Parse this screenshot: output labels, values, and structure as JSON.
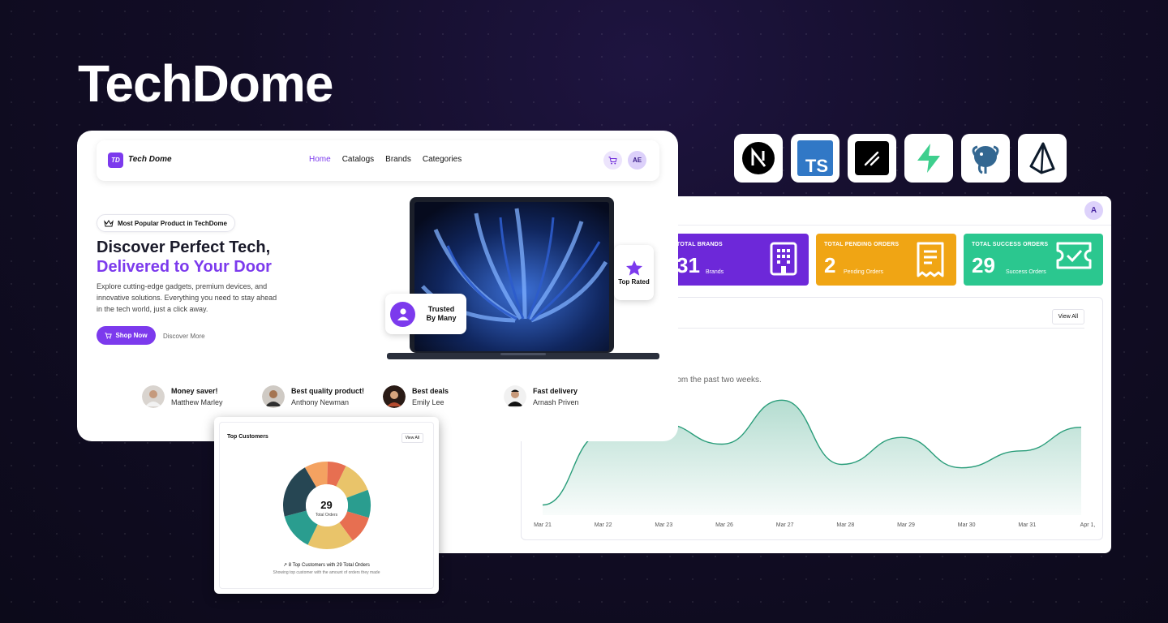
{
  "page_title": "TechDome",
  "badges": [
    "nextjs-icon",
    "typescript-icon",
    "shadcn-icon",
    "supabase-icon",
    "postgresql-icon",
    "prisma-icon"
  ],
  "badge_ts_text": "TS",
  "dashboard": {
    "avatar": "A",
    "stats": [
      {
        "label": "TOTAL BRANDS",
        "value": "31",
        "sub": "Brands",
        "color": "#6d28d9"
      },
      {
        "label": "TOTAL PENDING ORDERS",
        "value": "2",
        "sub": "Pending Orders",
        "color": "#f0a514"
      },
      {
        "label": "TOTAL SUCCESS ORDERS",
        "value": "29",
        "sub": "Success Orders",
        "color": "#2bc78f"
      }
    ],
    "view_all": "View All",
    "description": "rom the past two weeks.",
    "x_labels": [
      "Mar 21",
      "Mar 22",
      "Mar 23",
      "Mar 26",
      "Mar 27",
      "Mar 28",
      "Mar 29",
      "Mar 30",
      "Mar 31",
      "Apr 1,"
    ]
  },
  "chart_data": {
    "type": "area",
    "categories": [
      "Mar 21",
      "Mar 22",
      "Mar 23",
      "Mar 26",
      "Mar 27",
      "Mar 28",
      "Mar 29",
      "Mar 30",
      "Mar 31",
      "Apr 1,"
    ],
    "values": [
      0.3,
      2.4,
      2.7,
      2.1,
      3.4,
      1.5,
      2.3,
      1.4,
      1.9,
      2.6
    ],
    "title": "",
    "xlabel": "",
    "ylabel": "",
    "color": "#2a9d7a",
    "grid": false
  },
  "store": {
    "logo_mark": "TD",
    "logo_text": "Tech Dome",
    "nav_links": [
      "Home",
      "Catalogs",
      "Brands",
      "Categories"
    ],
    "user_initials": "AE",
    "pill": "Most Popular Product in TechDome",
    "headline_1": "Discover Perfect Tech,",
    "headline_2": "Delivered to Your Door",
    "paragraph": "Explore cutting-edge gadgets, premium devices, and innovative solutions. Everything you need to stay ahead in the tech world, just a click away.",
    "shop_now": "Shop Now",
    "discover_more": "Discover More",
    "trusted": "Trusted By Many",
    "top_rated": "Top Rated",
    "testimonials": [
      {
        "title": "Money saver!",
        "name": "Matthew Marley"
      },
      {
        "title": "Best quality product!",
        "name": "Anthony Newman"
      },
      {
        "title": "Best deals",
        "name": "Emily Lee"
      },
      {
        "title": "Fast delivery",
        "name": "Arnash Priven"
      }
    ]
  },
  "customers": {
    "title": "Top Customers",
    "view_all": "View All",
    "center_value": "29",
    "center_label": "Total Orders",
    "footer_1": "8 Top Customers with 29 Total Orders",
    "footer_2": "Showing top customer with the amount of orders they made",
    "segments": [
      {
        "value": 3.5,
        "color": "#e9c46a"
      },
      {
        "value": 3,
        "color": "#2a9d8f"
      },
      {
        "value": 3,
        "color": "#e76f51"
      },
      {
        "value": 5,
        "color": "#e9c46a"
      },
      {
        "value": 4,
        "color": "#2a9d8f"
      },
      {
        "value": 6,
        "color": "#264653"
      },
      {
        "value": 2.5,
        "color": "#f4a261"
      },
      {
        "value": 2,
        "color": "#e76f51"
      }
    ]
  }
}
